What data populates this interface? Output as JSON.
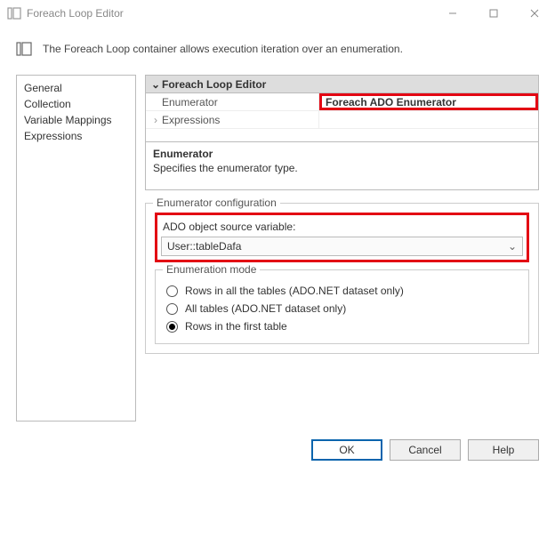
{
  "window": {
    "title": "Foreach Loop Editor",
    "description": "The Foreach Loop container allows execution iteration over an enumeration."
  },
  "sidebar": {
    "items": [
      {
        "label": "General"
      },
      {
        "label": "Collection"
      },
      {
        "label": "Variable Mappings"
      },
      {
        "label": "Expressions"
      }
    ]
  },
  "propGrid": {
    "groupHeader": "Foreach Loop Editor",
    "rows": [
      {
        "label": "Enumerator",
        "value": "Foreach ADO Enumerator",
        "highlighted": true,
        "expand": ""
      },
      {
        "label": "Expressions",
        "value": "",
        "expand": ">"
      }
    ],
    "help": {
      "title": "Enumerator",
      "text": "Specifies the enumerator type."
    }
  },
  "enumConfig": {
    "legend": "Enumerator configuration",
    "adoLabel": "ADO object source variable:",
    "adoValue": "User::tableDafa",
    "modeLegend": "Enumeration mode",
    "options": [
      {
        "label": "Rows in all the tables (ADO.NET dataset only)",
        "checked": false
      },
      {
        "label": "All tables (ADO.NET dataset only)",
        "checked": false
      },
      {
        "label": "Rows in the first table",
        "checked": true
      }
    ]
  },
  "buttons": {
    "ok": "OK",
    "cancel": "Cancel",
    "help": "Help"
  }
}
